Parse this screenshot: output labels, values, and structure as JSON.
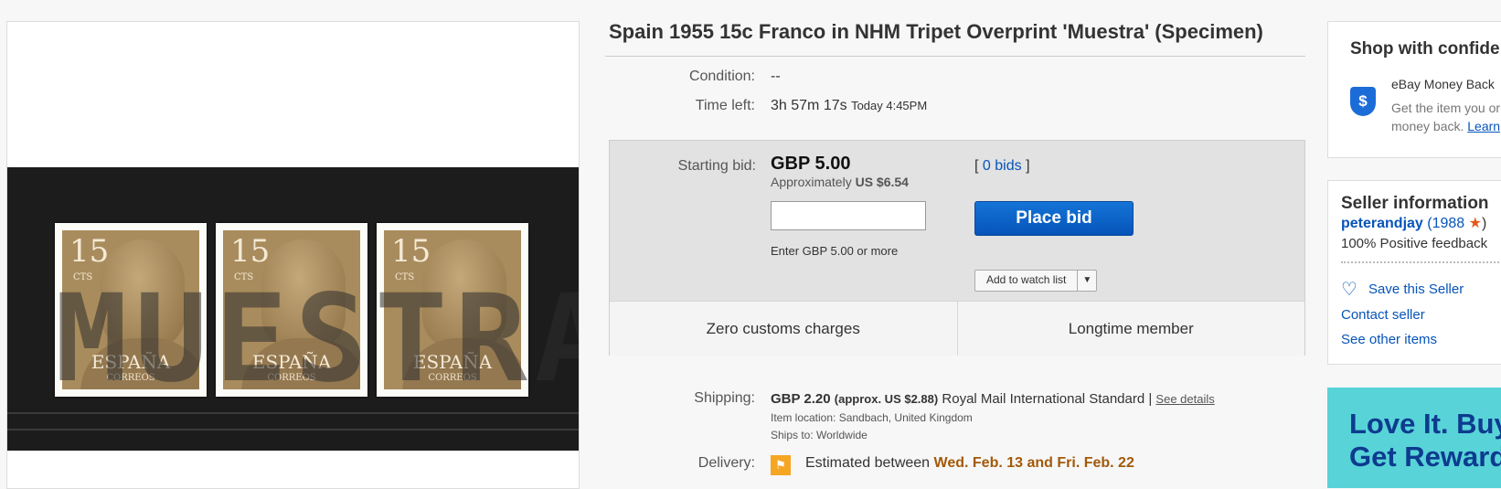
{
  "listing": {
    "title": "Spain 1955 15c Franco in NHM Tripet Overprint 'Muestra' (Specimen)"
  },
  "image": {
    "stamp_value": "15",
    "stamp_cts": "CTS",
    "stamp_country": "ESPAÑA",
    "stamp_sub": "CORREOS",
    "overprint": "MUESTRA"
  },
  "details": {
    "condition_label": "Condition:",
    "condition_value": "--",
    "time_left_label": "Time left:",
    "time_left_value": "3h 57m 17s",
    "time_left_today": "Today 4:45PM"
  },
  "bid": {
    "starting_bid_label": "Starting bid:",
    "price": "GBP 5.00",
    "approx_prefix": "Approximately",
    "approx_value": "US $6.54",
    "bids_open": "[",
    "bids_link": "0 bids",
    "bids_close": "]",
    "input_value": "",
    "hint": "Enter GBP 5.00 or more",
    "place_bid_label": "Place bid",
    "watch_label": "Add to watch list"
  },
  "badges": [
    "Zero customs charges",
    "Longtime member"
  ],
  "shipping": {
    "label": "Shipping:",
    "amount": "GBP 2.20",
    "approx": "(approx. US $2.88)",
    "service": "Royal Mail International Standard |",
    "details_link": "See details",
    "item_location": "Item location:  Sandbach, United Kingdom",
    "ships_to": "Ships to:  Worldwide"
  },
  "delivery": {
    "label": "Delivery:",
    "prefix": "Estimated between",
    "dates": "Wed. Feb. 13 and Fri. Feb. 22"
  },
  "shop": {
    "title": "Shop with confide",
    "money_back_title": "eBay Money Back",
    "money_back_text": "Get the item you or money back.",
    "learn_link": "Learn"
  },
  "seller": {
    "title": "Seller information",
    "name": "peterandjay",
    "score_open": "(",
    "score": "1988",
    "score_close": ")",
    "feedback": "100% Positive feedback",
    "save": "Save this Seller",
    "contact": "Contact seller",
    "other": "See other items"
  },
  "ad": {
    "line1": "Love It. Buy",
    "line2": "Get Reward"
  }
}
